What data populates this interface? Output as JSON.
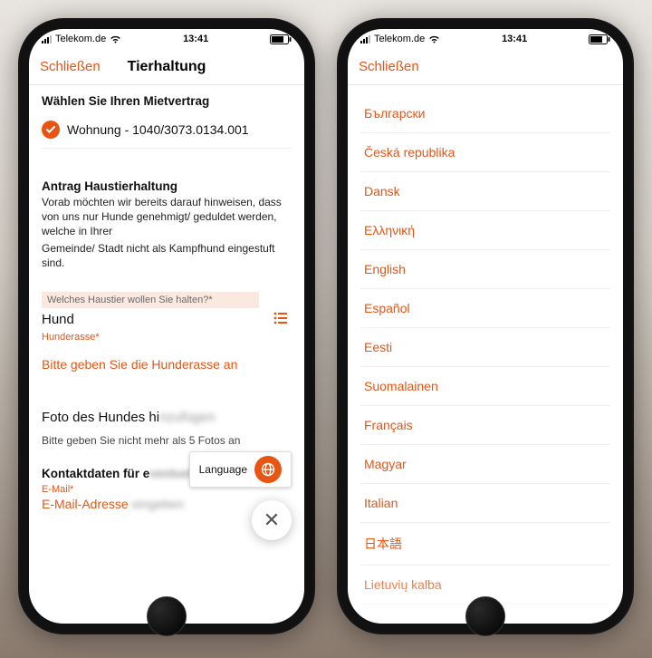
{
  "status": {
    "carrier": "Telekom.de",
    "time": "13:41"
  },
  "phone1": {
    "nav": {
      "close": "Schließen",
      "title": "Tierhaltung"
    },
    "select_contract_title": "Wählen Sie Ihren Mietvertrag",
    "contract": "Wohnung - 1040/3073.0134.001",
    "app_title": "Antrag Haustierhaltung",
    "app_text1": "Vorab möchten wir bereits darauf hinweisen, dass von uns nur Hunde genehmigt/  geduldet werden, welche in Ihrer",
    "app_text2": "Gemeinde/ Stadt nicht als Kampfhund eingestuft sind.",
    "field_label": "Welches Haustier wollen Sie halten?*",
    "field_value": "Hund",
    "breed_req": "Hunderasse*",
    "breed_error": "Bitte geben Sie die Hunderasse an",
    "photo_title_prefix": "Foto des Hundes hi",
    "hint_prefix": "Bitte geben Sie nicht me",
    "kontakt_prefix": "Kontaktdaten für e",
    "email_label": "E-Mail*",
    "email_row_prefix": "E-Mail-Adresse ",
    "lang_label": "Language"
  },
  "phone2": {
    "nav": {
      "close": "Schließen"
    },
    "languages": [
      "Български",
      "Česká republika",
      "Dansk",
      "Ελληνική",
      "English",
      "Español",
      "Eesti",
      "Suomalainen",
      "Français",
      "Magyar",
      "Italian",
      "日本語",
      "Lietuvių kalba"
    ]
  }
}
